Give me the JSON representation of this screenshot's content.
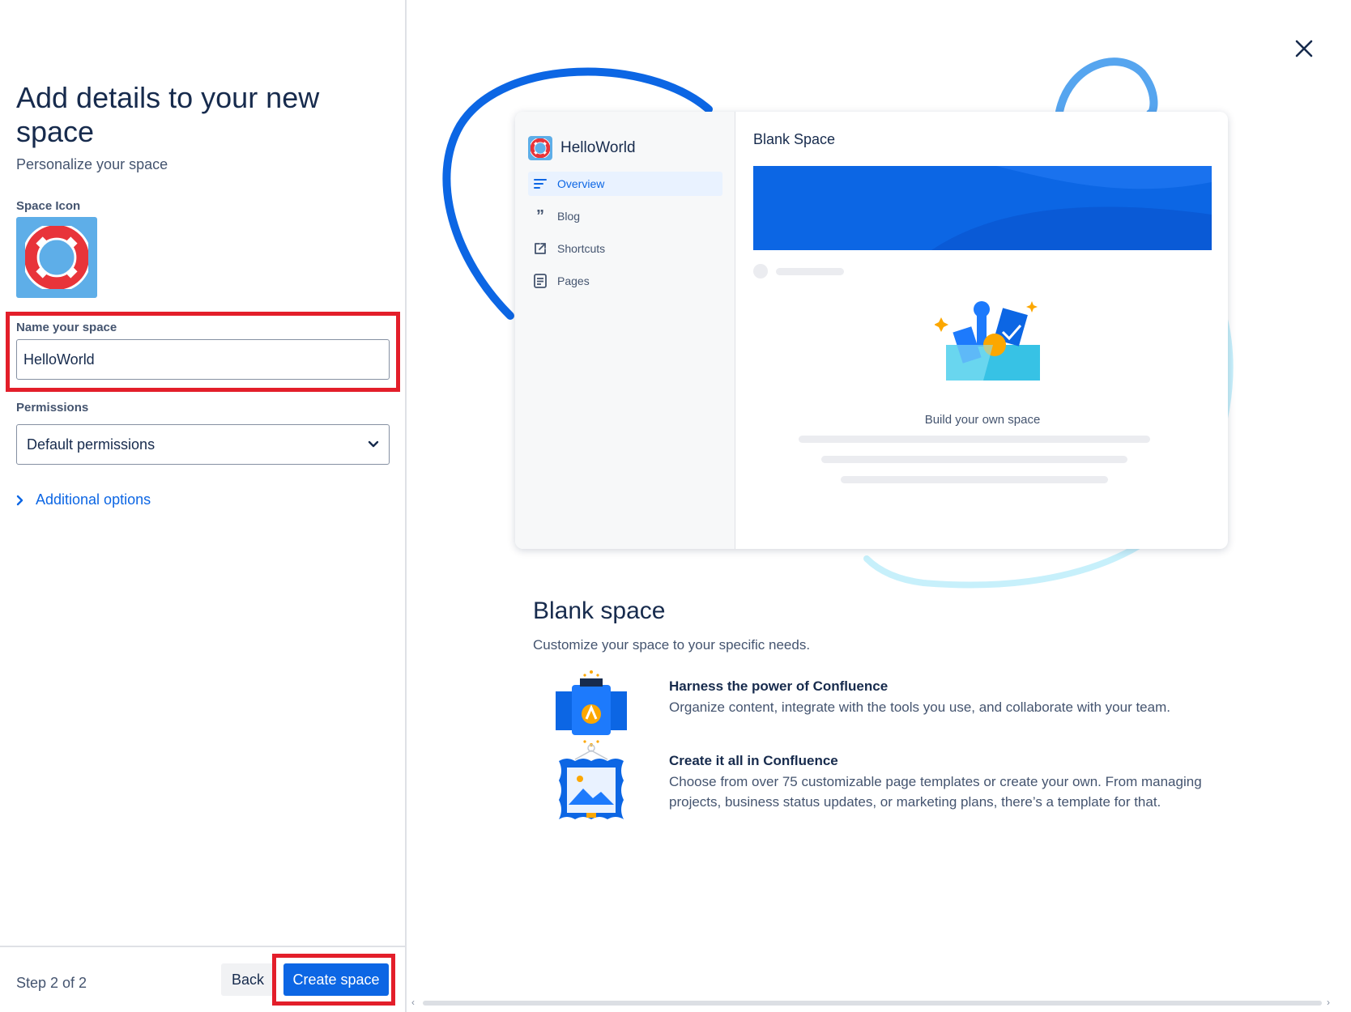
{
  "left": {
    "title": "Add details to your new space",
    "subtitle": "Personalize your space",
    "space_icon_label": "Space Icon",
    "name_label": "Name your space",
    "name_value": "HelloWorld",
    "permissions_label": "Permissions",
    "permissions_value": "Default permissions",
    "additional_options": "Additional options"
  },
  "footer": {
    "step": "Step 2 of 2",
    "back": "Back",
    "create": "Create space"
  },
  "preview": {
    "space_name": "HelloWorld",
    "nav": [
      {
        "label": "Overview",
        "icon": "overview-icon"
      },
      {
        "label": "Blog",
        "icon": "quote-icon"
      },
      {
        "label": "Shortcuts",
        "icon": "external-link-icon"
      },
      {
        "label": "Pages",
        "icon": "page-icon"
      }
    ],
    "main_title": "Blank Space",
    "build_label": "Build your own space"
  },
  "template": {
    "title": "Blank space",
    "description": "Customize your space to your specific needs.",
    "features": [
      {
        "title": "Harness the power of Confluence",
        "description": "Organize content, integrate with the tools you use, and collaborate with your team."
      },
      {
        "title": "Create it all in Confluence",
        "description": "Choose from over 75 customizable page templates or create your own. From managing projects, business status updates, or marketing plans, there’s a template for that."
      }
    ]
  },
  "colors": {
    "primary": "#0c66e4",
    "highlight": "#e31e2a",
    "icon_bg": "#5eaee8",
    "text": "#172b4d"
  }
}
